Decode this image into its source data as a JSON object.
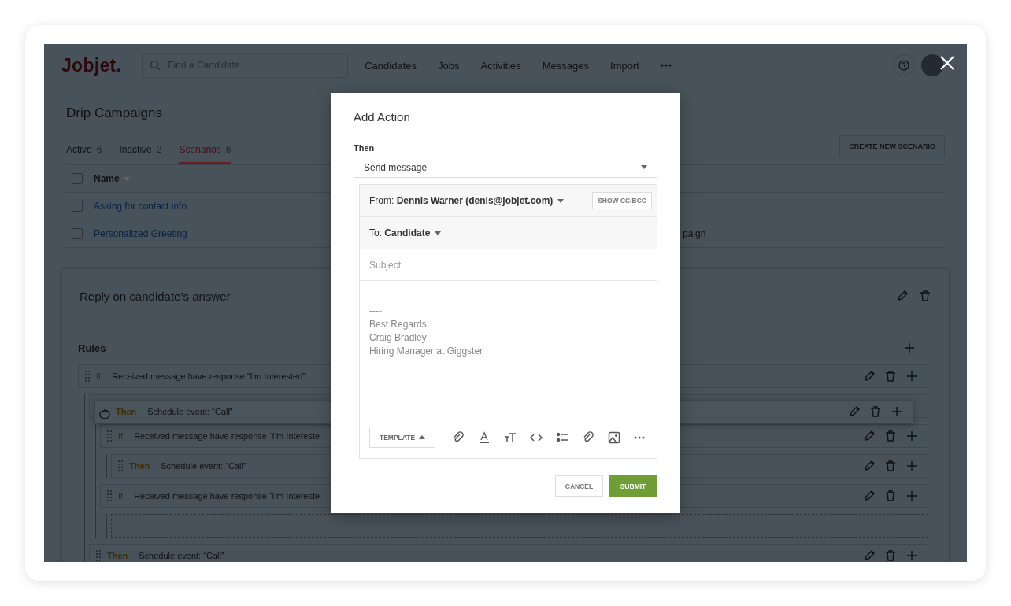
{
  "nav": {
    "logo": "Jobjet.",
    "search": {
      "placeholder": "Find a Candidate"
    },
    "items": [
      "Candidates",
      "Jobs",
      "Activities",
      "Messages",
      "Import"
    ]
  },
  "page_title": "Drip Campaigns",
  "tabs": [
    {
      "label": "Active",
      "count": "6",
      "selected": false
    },
    {
      "label": "Inactive",
      "count": "2",
      "selected": false
    },
    {
      "label": "Scenarios",
      "count": "6",
      "selected": true
    }
  ],
  "create_button": "CREATE NEW SCENARIO",
  "table": {
    "columns": [
      {
        "label": "Name"
      }
    ],
    "header_checked": false,
    "rows": [
      {
        "name": "Asking for contact info",
        "checked": false
      },
      {
        "name": "Personalized Greeting",
        "checked": false,
        "column_2": "paign"
      }
    ]
  },
  "scenario": {
    "title": "Reply on candidate’s answer",
    "rules_label": "Rules",
    "rules": [
      {
        "kind": "if",
        "keyword": "If",
        "text": "Received message have response “I’m Interested”",
        "children": [
          {
            "kind": "then",
            "children": [
              {
                "kind": "if",
                "keyword": "If",
                "text": "Received message have response “I’m Intereste",
                "children": [
                  {
                    "kind": "then",
                    "keyword": "Then",
                    "text": "Schedule event: “Call”"
                  }
                ]
              },
              {
                "kind": "if",
                "keyword": "If",
                "text": "Received message have response “I’m Intereste",
                "children": [
                  {
                    "kind": "drop"
                  }
                ]
              }
            ]
          },
          {
            "kind": "then",
            "keyword": "Then",
            "text": "Schedule event: “Call”"
          }
        ]
      }
    ]
  },
  "dragged_rule": {
    "kind": "then",
    "keyword": "Then",
    "text": "Schedule event: “Call”"
  },
  "modal": {
    "title": "Add Action",
    "field_label": "Then",
    "select_value": "Send message",
    "from_label": "From:",
    "from_value": "Dennis Warner (denis@jobjet.com)",
    "cc_button": "SHOW CC/BCC",
    "to_label": "To:",
    "to_value": "Candidate",
    "subject_placeholder": "Subject",
    "body_lines": [
      "----",
      "Best Regards,",
      "Craig Bradley",
      "Hiring Manager at Giggster"
    ],
    "template_button": "TEMPLATE",
    "cancel": "CANCEL",
    "submit": "SUBMIT"
  }
}
